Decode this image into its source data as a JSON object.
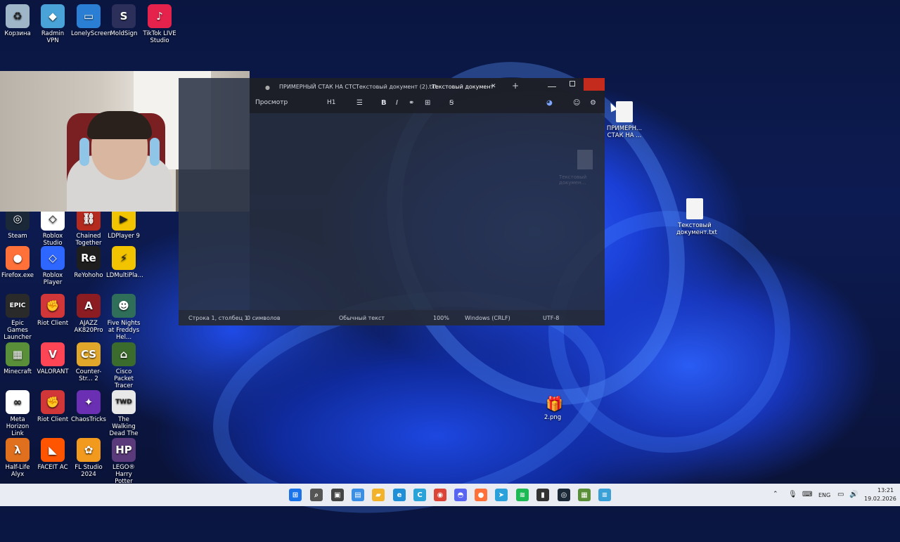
{
  "desktop_left": [
    {
      "label": "Корзина",
      "icon": "recycle-bin-icon",
      "color": "#9fb6c9",
      "glyph": "♻"
    },
    {
      "label": "Radmin VPN",
      "icon": "radmin-vpn-icon",
      "color": "#4aa3d8",
      "glyph": "◆"
    },
    {
      "label": "LonelyScreen",
      "icon": "lonelyscreen-icon",
      "color": "#2a7fd4",
      "glyph": "▭"
    },
    {
      "label": "MoldSign",
      "icon": "moldsign-icon",
      "color": "#2b2f5a",
      "glyph": "S"
    },
    {
      "label": "TikTok LIVE Studio",
      "icon": "tiktok-icon",
      "color": "#e5224b",
      "glyph": "♪"
    },
    {
      "label": "Steam",
      "icon": "steam-icon",
      "color": "#1b2838",
      "glyph": "◎"
    },
    {
      "label": "Roblox Studio",
      "icon": "roblox-studio-icon",
      "color": "#ffffff",
      "glyph": "◇"
    },
    {
      "label": "Chained Together",
      "icon": "chained-together-icon",
      "color": "#b42a1e",
      "glyph": "⛓"
    },
    {
      "label": "LDPlayer 9",
      "icon": "ldplayer-icon",
      "color": "#f2c400",
      "glyph": "▶"
    },
    {
      "label": "Firefox.exe",
      "icon": "firefox-icon",
      "color": "#ff7139",
      "glyph": "●"
    },
    {
      "label": "Roblox Player",
      "icon": "roblox-player-icon",
      "color": "#2e67ff",
      "glyph": "◇"
    },
    {
      "label": "ReYohoho",
      "icon": "reyohoho-icon",
      "color": "#1e1e1e",
      "glyph": "Re"
    },
    {
      "label": "LDMultiPla...",
      "icon": "ldmultiplayer-icon",
      "color": "#f2c400",
      "glyph": "⚡"
    },
    {
      "label": "Epic Games Launcher",
      "icon": "epic-games-icon",
      "color": "#2a2a2a",
      "glyph": "EPIC"
    },
    {
      "label": "Riot Client",
      "icon": "riot-client-icon",
      "color": "#d13639",
      "glyph": "✊"
    },
    {
      "label": "AJAZZ AK820Pro",
      "icon": "ajazz-icon",
      "color": "#8b1c22",
      "glyph": "A"
    },
    {
      "label": "Five Nights at Freddys Hel...",
      "icon": "fnaf-icon",
      "color": "#2f6f5a",
      "glyph": "☻"
    },
    {
      "label": "Minecraft",
      "icon": "minecraft-icon",
      "color": "#5a8f3a",
      "glyph": "▦"
    },
    {
      "label": "VALORANT",
      "icon": "valorant-icon",
      "color": "#fd4556",
      "glyph": "V"
    },
    {
      "label": "Counter-Str... 2",
      "icon": "cs2-icon",
      "color": "#e0a72b",
      "glyph": "CS"
    },
    {
      "label": "Cisco Packet Tracer",
      "icon": "cisco-icon",
      "color": "#3b6b2d",
      "glyph": "⌂"
    },
    {
      "label": "Meta Horizon Link",
      "icon": "meta-icon",
      "color": "#ffffff",
      "glyph": "∞"
    },
    {
      "label": "Riot Client",
      "icon": "riot-client-icon",
      "color": "#d13639",
      "glyph": "✊"
    },
    {
      "label": "ChaosTricks",
      "icon": "chaostricks-icon",
      "color": "#6b2fb3",
      "glyph": "✦"
    },
    {
      "label": "The Walking Dead The ...",
      "icon": "walking-dead-icon",
      "color": "#e8e8e8",
      "glyph": "TWD"
    },
    {
      "label": "Half-Life Alyx",
      "icon": "half-life-icon",
      "color": "#e0701e",
      "glyph": "λ"
    },
    {
      "label": "FACEIT AC",
      "icon": "faceit-icon",
      "color": "#ff5500",
      "glyph": "◣"
    },
    {
      "label": "FL Studio 2024",
      "icon": "fl-studio-icon",
      "color": "#f29a1e",
      "glyph": "✿"
    },
    {
      "label": "LEGO® Harry Potter Years...",
      "icon": "lego-hp-icon",
      "color": "#5a3a7a",
      "glyph": "HP"
    }
  ],
  "desktop_right": [
    {
      "label": "ПРИМЕРН... СТАК НА ...",
      "icon": "text-file-icon"
    },
    {
      "label": "Текстовый документ.txt",
      "icon": "text-file-icon"
    },
    {
      "label": "2.png",
      "icon": "image-file-icon"
    }
  ],
  "notepad": {
    "tabs": [
      "ПРИМЕРНЫЙ СТАК НА СТС",
      "Текстовый документ (2).txt",
      "Текстовый документ"
    ],
    "new_tab": "+",
    "close_tab": "✕",
    "menu_view": "Просмотр",
    "heading": "H1",
    "bold": "B",
    "italic": "I",
    "status": {
      "position": "Строка 1, столбец 1",
      "chars": "0 символов",
      "format": "Обычный текст",
      "zoom": "100%",
      "eol": "Windows (CRLF)",
      "encoding": "UTF-8"
    },
    "ghost_label": "Текстовый докумен..."
  },
  "taskbar": {
    "apps": [
      {
        "icon": "windows-start-icon",
        "color": "#1a73e8",
        "glyph": "⊞"
      },
      {
        "icon": "search-icon",
        "color": "#555555",
        "glyph": "⌕"
      },
      {
        "icon": "task-view-icon",
        "color": "#444444",
        "glyph": "▣"
      },
      {
        "icon": "widgets-icon",
        "color": "#3a8ee6",
        "glyph": "▤"
      },
      {
        "icon": "file-explorer-icon",
        "color": "#f2b32b",
        "glyph": "▰"
      },
      {
        "icon": "edge-icon",
        "color": "#1f8fd8",
        "glyph": "e"
      },
      {
        "icon": "ccleaner-icon",
        "color": "#2aa3d9",
        "glyph": "C"
      },
      {
        "icon": "chrome-icon",
        "color": "#db4437",
        "glyph": "◉"
      },
      {
        "icon": "discord-icon",
        "color": "#5865f2",
        "glyph": "◓"
      },
      {
        "icon": "firefox-icon",
        "color": "#ff7139",
        "glyph": "●"
      },
      {
        "icon": "telegram-icon",
        "color": "#2aa1da",
        "glyph": "➤"
      },
      {
        "icon": "spotify-icon",
        "color": "#1db954",
        "glyph": "≋"
      },
      {
        "icon": "usb-icon",
        "color": "#333333",
        "glyph": "▮"
      },
      {
        "icon": "steam-icon",
        "color": "#1b2838",
        "glyph": "◎"
      },
      {
        "icon": "minecraft-icon",
        "color": "#5a8f3a",
        "glyph": "▦"
      },
      {
        "icon": "notepad-icon",
        "color": "#3aa0d8",
        "glyph": "≡"
      }
    ],
    "lang": "ENG",
    "time": "13:21",
    "date": "19.02.2026"
  }
}
